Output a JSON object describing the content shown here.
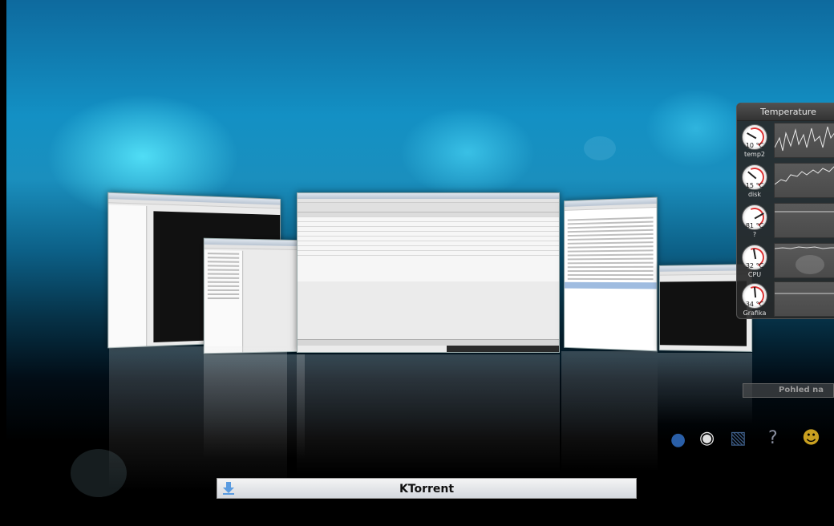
{
  "active_window": {
    "label": "KTorrent",
    "icon": "ktorrent-download-icon"
  },
  "temperature_widget": {
    "title": "Temperature",
    "sensors": [
      {
        "value": "10 °C",
        "name": "temp2"
      },
      {
        "value": "15 °C",
        "name": "disk"
      },
      {
        "value": "81 °C",
        "name": "?"
      },
      {
        "value": "32 °C",
        "name": "CPU"
      },
      {
        "value": "34 °C",
        "name": "Grafika"
      }
    ]
  },
  "partial_widget": {
    "label": "Pohled na"
  },
  "colors": {
    "desktop_top": "#0e6a9e",
    "glow": "#5aebff",
    "widget_bg": "#282828"
  }
}
